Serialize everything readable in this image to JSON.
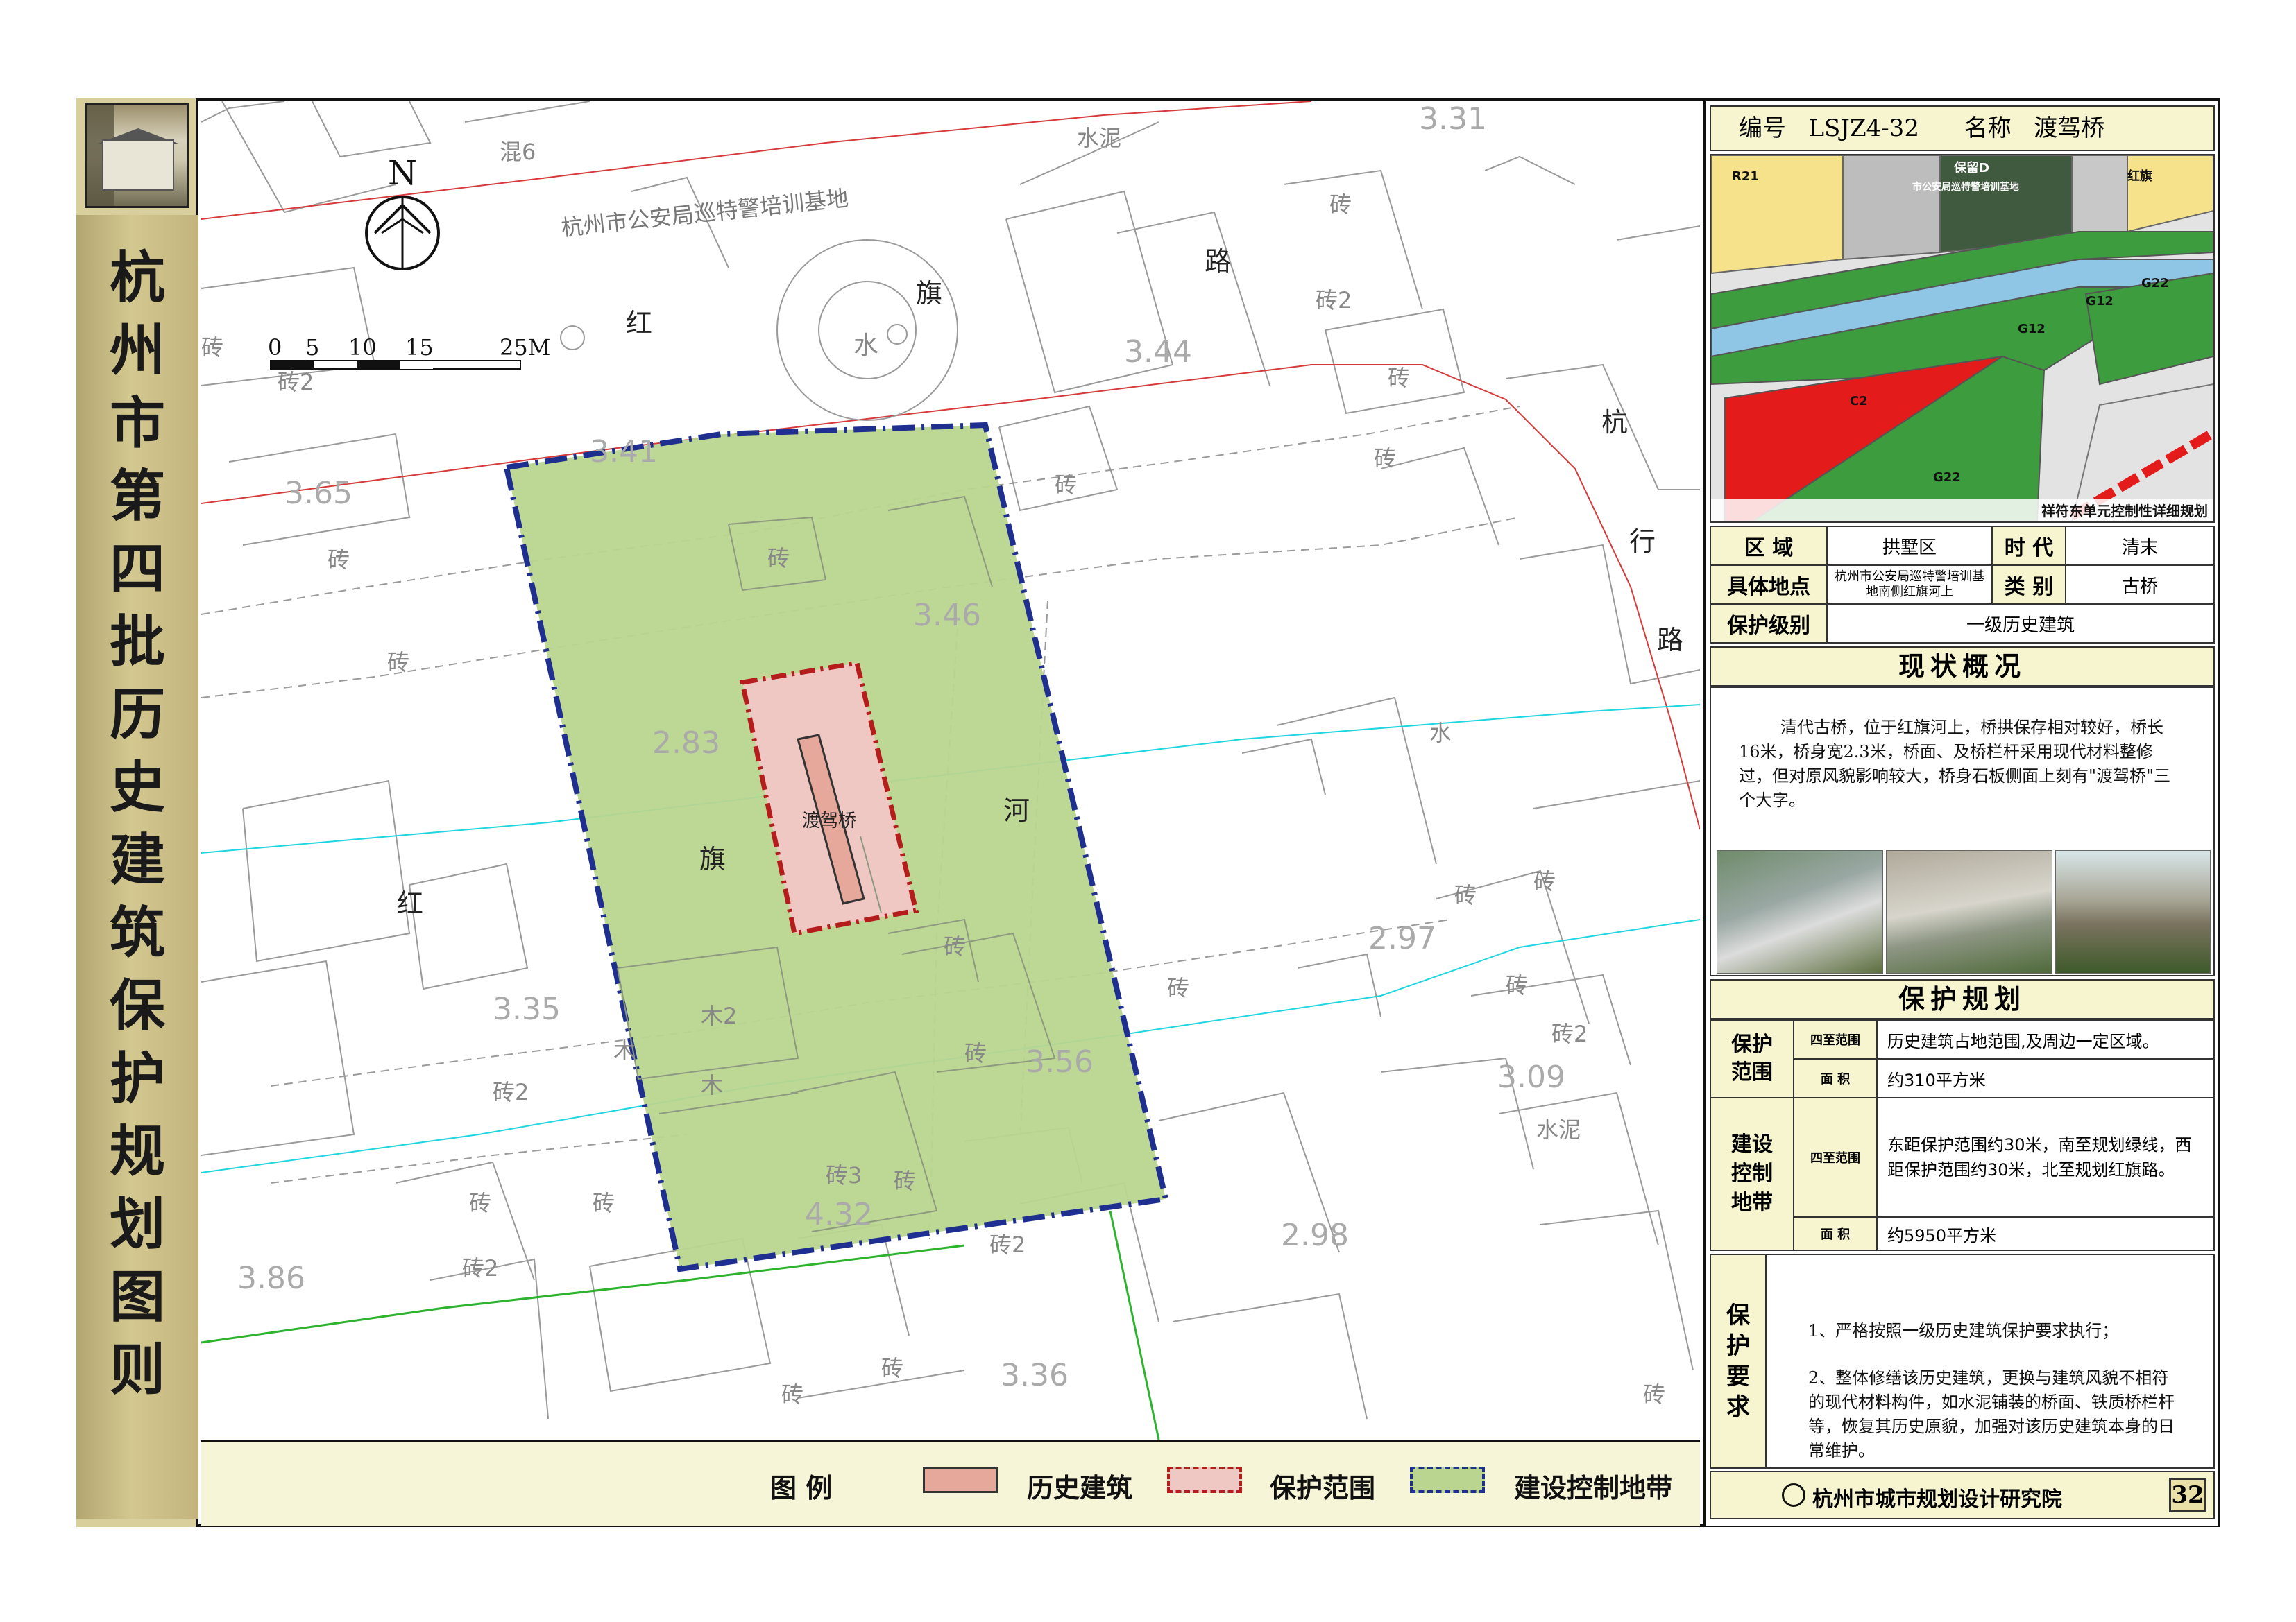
{
  "sidebar": {
    "title_chars": [
      "杭",
      "州",
      "市",
      "第",
      "四",
      "批",
      "历",
      "史",
      "建",
      "筑",
      "保",
      "护",
      "规",
      "划",
      "图",
      "则"
    ]
  },
  "map": {
    "north": "N",
    "scale": {
      "labels": [
        "0",
        "5",
        "10",
        "15",
        "25M"
      ]
    },
    "area_label_training_base": "杭州市公安局巡特警培训基地",
    "road_chars_hongqi": [
      "红",
      "旗",
      "路"
    ],
    "road_chars_hangxing": [
      "杭",
      "行",
      "路"
    ],
    "river_chars": [
      "红",
      "旗",
      "河"
    ],
    "bridge_label": "渡驾桥",
    "circle_label": "水",
    "elevations": [
      "3.31",
      "3.44",
      "3.65",
      "3.41",
      "3.46",
      "2.83",
      "2.97",
      "3.35",
      "3.56",
      "3.09",
      "3.86",
      "4.32",
      "2.98",
      "3.36"
    ],
    "material_labels": {
      "hun6": "混6",
      "shuini": "水泥",
      "zhuan": "砖",
      "zhuan2": "砖2",
      "mu2": "木2",
      "mu": "木",
      "zhuan3": "砖3",
      "shui": "水"
    }
  },
  "legend": {
    "title": "图  例",
    "items": [
      {
        "label": "历史建筑",
        "color": "#e5a89a",
        "border": "#333333"
      },
      {
        "label": "保护范围",
        "color": "#efc8c4",
        "border": "#b51c1c"
      },
      {
        "label": "建设控制地带",
        "color": "#b9d58f",
        "border": "#1f2f8f"
      }
    ]
  },
  "panel": {
    "header": {
      "number_label": "编号",
      "number": "LSJZ4-32",
      "name_label": "名称",
      "name": "渡驾桥"
    },
    "plan_map": {
      "labels": [
        "R21",
        "保留D",
        "市公安局巡特警培训基地",
        "G22",
        "G12",
        "G12",
        "C2",
        "G22",
        "红旗"
      ],
      "caption": "祥符东单元控制性详细规划",
      "colors": {
        "residential": "#f5e28a",
        "green": "#3d9c3d",
        "red": "#e31b1b",
        "river": "#8fc6e6",
        "dark": "#3f5a3f"
      }
    },
    "info": {
      "region_label": "区    域",
      "region": "拱墅区",
      "era_label": "时 代",
      "era": "清末",
      "location_label": "具体地点",
      "location": "杭州市公安局巡特警培训基地南侧红旗河上",
      "type_label": "类 别",
      "type": "古桥",
      "level_label": "保护级别",
      "level": "一级历史建筑"
    },
    "status": {
      "title": "现状概况",
      "text": "清代古桥，位于红旗河上，桥拱保存相对较好，桥长16米，桥身宽2.3米，桥面、及桥栏杆采用现代材料整修过，但对原风貌影响较大，桥身石板侧面上刻有\"渡驾桥\"三个大字。"
    },
    "plan": {
      "title": "保护规划",
      "protect_label": "保护范围",
      "protect_bounds_label": "四至范围",
      "protect_bounds": "历史建筑占地范围,及周边一定区域。",
      "protect_area_label": "面    积",
      "protect_area": "约310平方米",
      "control_label": "建设控制地带",
      "control_bounds_label": "四至范围",
      "control_bounds": "东距保护范围约30米，南至规划绿线，西距保护范围约30米，北至规划红旗路。",
      "control_area_label": "面    积",
      "control_area": "约5950平方米"
    },
    "requirements": {
      "label": "保护要求",
      "item1": "1、严格按照一级历史建筑保护要求执行；",
      "item2": "2、整体修缮该历史建筑，更换与建筑风貌不相符的现代材料构件，如水泥铺装的桥面、铁质桥栏杆等，恢复其历史原貌，加强对该历史建筑本身的日常维护。"
    },
    "footer": {
      "institute": "杭州市城市规划设计研究院",
      "page": "32"
    }
  }
}
